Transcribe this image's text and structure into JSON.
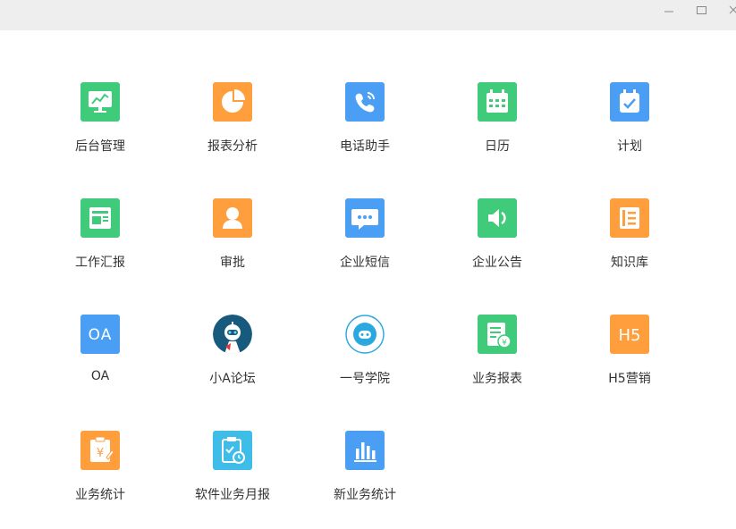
{
  "window": {
    "minimize_icon": "minimize-icon",
    "maximize_icon": "maximize-icon",
    "close_icon": "close-icon"
  },
  "apps": [
    {
      "label": "后台管理",
      "icon": "monitor-chart-icon",
      "color": "#3fcb7a"
    },
    {
      "label": "报表分析",
      "icon": "pie-chart-icon",
      "color": "#ff9e3d"
    },
    {
      "label": "电话助手",
      "icon": "phone-icon",
      "color": "#4a9ff5"
    },
    {
      "label": "日历",
      "icon": "calendar-icon",
      "color": "#3fcb7a"
    },
    {
      "label": "计划",
      "icon": "plan-check-icon",
      "color": "#4a9ff5"
    },
    {
      "label": "工作汇报",
      "icon": "report-card-icon",
      "color": "#3fcb7a"
    },
    {
      "label": "审批",
      "icon": "person-icon",
      "color": "#ff9e3d"
    },
    {
      "label": "企业短信",
      "icon": "sms-bubble-icon",
      "color": "#4a9ff5"
    },
    {
      "label": "企业公告",
      "icon": "speaker-icon",
      "color": "#3fcb7a"
    },
    {
      "label": "知识库",
      "icon": "book-icon",
      "color": "#ff9e3d"
    },
    {
      "label": "OA",
      "icon": "oa-icon",
      "color": "#4a9ff5"
    },
    {
      "label": "小A论坛",
      "icon": "robot-avatar-icon",
      "color": "#1e6fa0"
    },
    {
      "label": "一号学院",
      "icon": "academy-logo-icon",
      "color": "#2aa9e0"
    },
    {
      "label": "业务报表",
      "icon": "business-report-icon",
      "color": "#3fcb7a"
    },
    {
      "label": "H5营销",
      "icon": "h5-icon",
      "color": "#ff9e3d"
    },
    {
      "label": "业务统计",
      "icon": "clipboard-yen-icon",
      "color": "#ff9e3d"
    },
    {
      "label": "软件业务月报",
      "icon": "clipboard-clock-icon",
      "color": "#3dbde8"
    },
    {
      "label": "新业务统计",
      "icon": "bar-chart-icon",
      "color": "#4a9ff5"
    }
  ]
}
